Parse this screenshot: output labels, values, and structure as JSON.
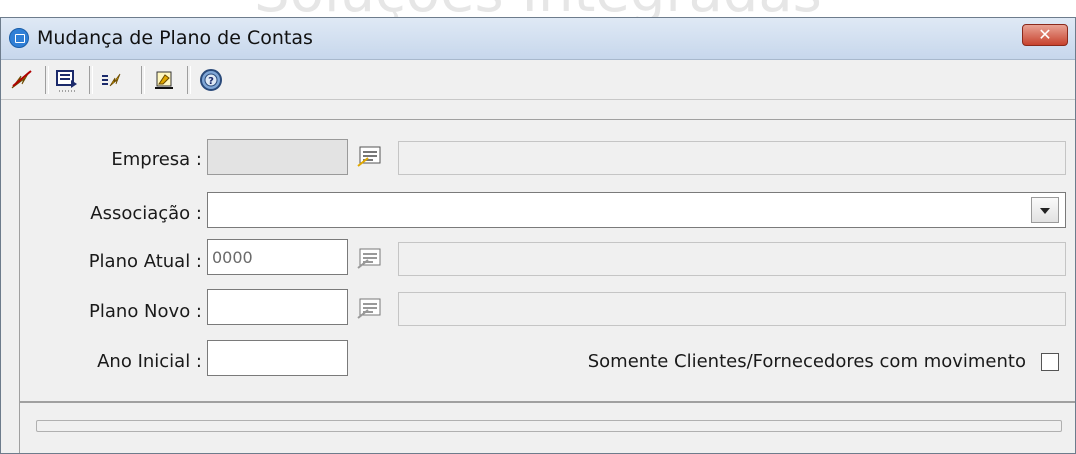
{
  "watermark": "Soluções Integradas",
  "window": {
    "title": "Mudança de Plano de Contas",
    "close_label": "✕"
  },
  "toolbar": {
    "buttons": [
      "confirm-icon",
      "edit-icon",
      "process-icon",
      "report-icon",
      "help-icon"
    ]
  },
  "form": {
    "empresa_label": "Empresa :",
    "empresa_value": "",
    "associacao_label": "Associação :",
    "associacao_value": "",
    "plano_atual_label": "Plano Atual :",
    "plano_atual_value": "0000",
    "plano_novo_label": "Plano Novo :",
    "plano_novo_value": "",
    "ano_inicial_label": "Ano Inicial :",
    "ano_inicial_value": "",
    "somente_label": "Somente Clientes/Fornecedores com movimento",
    "somente_checked": false
  },
  "colors": {
    "titlebar": "#c7d7ec",
    "close": "#c7432e",
    "window": "#f0f0f0"
  }
}
